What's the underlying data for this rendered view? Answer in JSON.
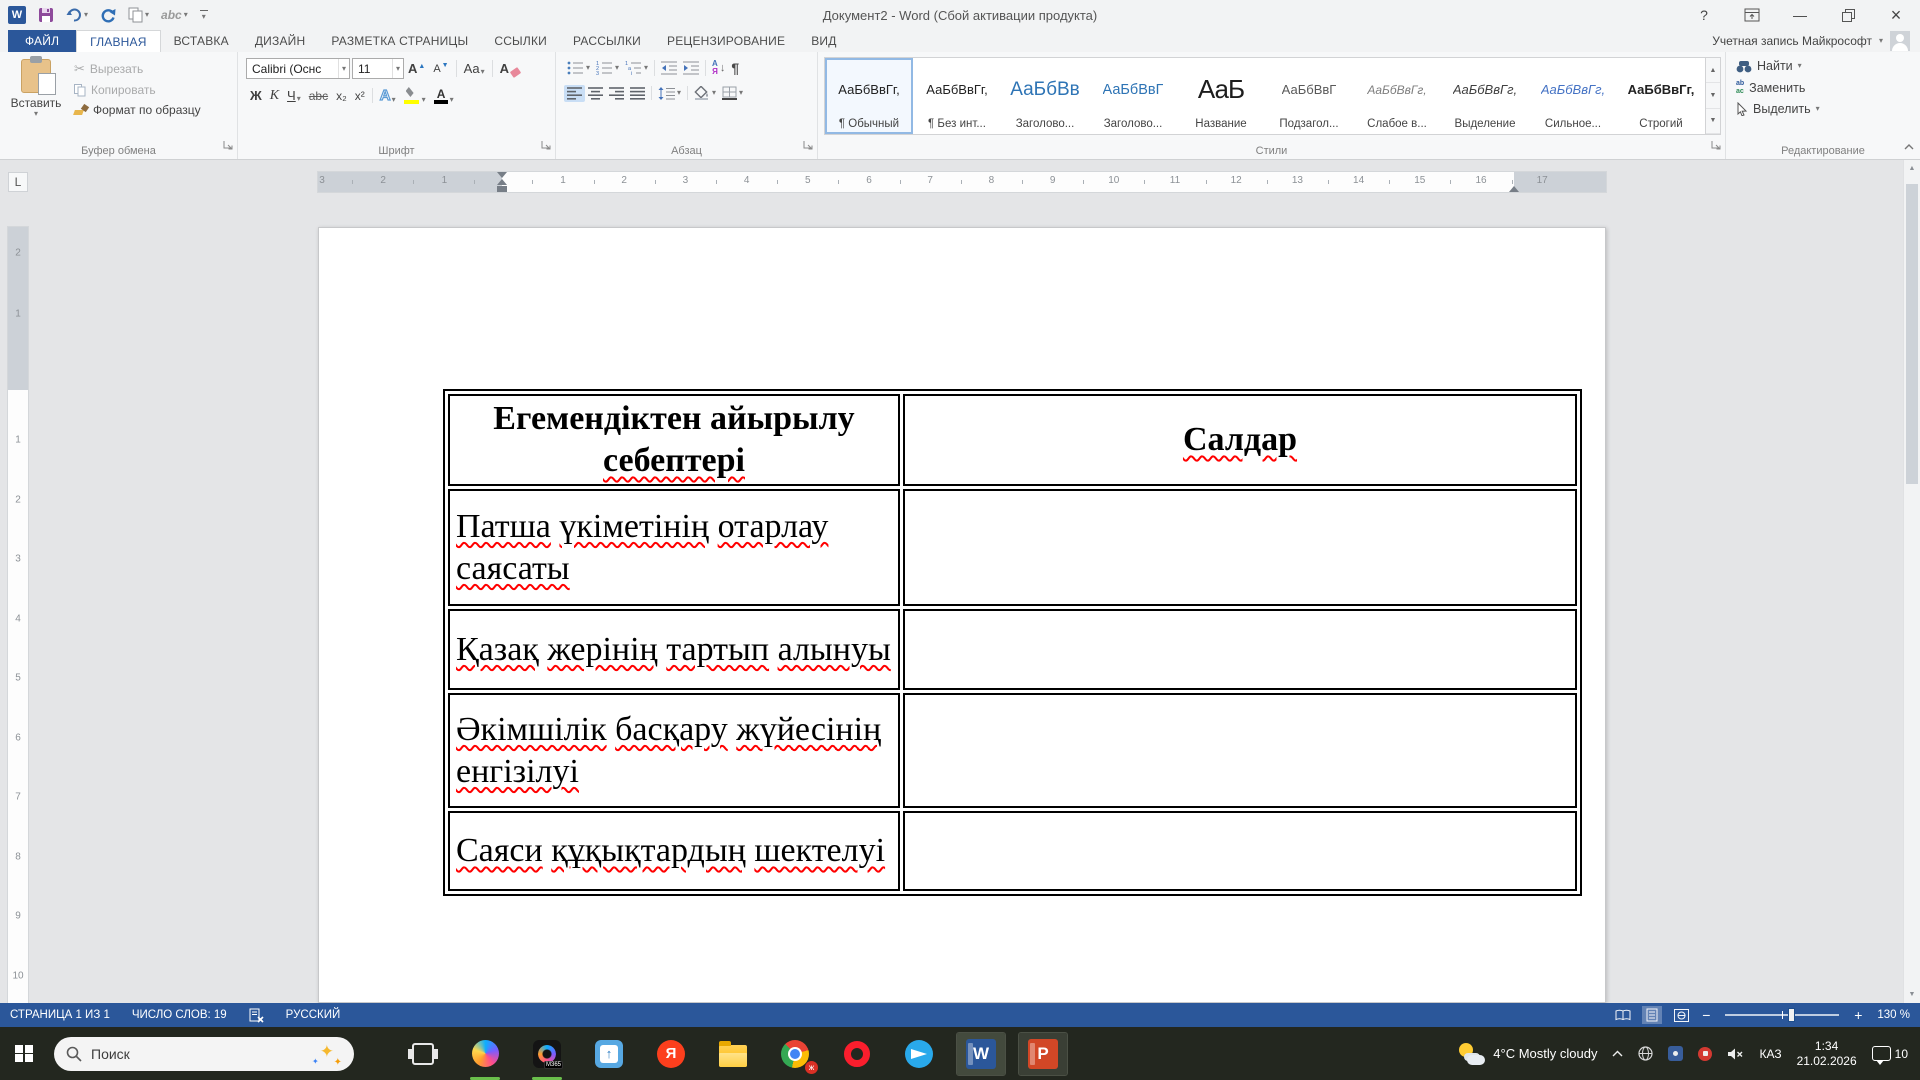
{
  "window": {
    "title": "Документ2 - Word (Сбой активации продукта)",
    "help": "?",
    "minimize": "—",
    "close": "×"
  },
  "qat": {
    "spelling_label": "abc"
  },
  "apps": {
    "word_letter": "W",
    "ppt_letter": "P",
    "yandex_letter": "Я",
    "m365_label": "M365",
    "chrome_badge": "ж"
  },
  "tabs": {
    "file": "ФАЙЛ",
    "active": "ГЛАВНАЯ",
    "items": [
      "ГЛАВНАЯ",
      "ВСТАВКА",
      "ДИЗАЙН",
      "РАЗМЕТКА СТРАНИЦЫ",
      "ССЫЛКИ",
      "РАССЫЛКИ",
      "РЕЦЕНЗИРОВАНИЕ",
      "ВИД"
    ],
    "account": "Учетная запись Майкрософт"
  },
  "ribbon": {
    "clipboard": {
      "label": "Буфер обмена",
      "paste": "Вставить",
      "cut": "Вырезать",
      "copy": "Копировать",
      "format_painter": "Формат по образцу"
    },
    "font": {
      "label": "Шрифт",
      "name": "Calibri (Оснс",
      "size": "11",
      "grow": "А",
      "shrink": "А",
      "case_btn": "Аа",
      "clear": "А",
      "bold": "Ж",
      "italic": "К",
      "underline": "Ч",
      "strike": "abc",
      "subscript": "x₂",
      "superscript": "x²",
      "effects": "А",
      "color_letter": "А"
    },
    "paragraph": {
      "label": "Абзац",
      "sort_a": "А",
      "sort_b": "Я",
      "pilcrow": "¶"
    },
    "styles": {
      "label": "Стили",
      "items": [
        {
          "preview": "АаБбВвГг,",
          "name": "¶ Обычный",
          "cls": "st-normal",
          "selected": true
        },
        {
          "preview": "АаБбВвГг,",
          "name": "¶ Без инт...",
          "cls": "st-normal",
          "selected": false
        },
        {
          "preview": "АаБбВв",
          "name": "Заголово...",
          "cls": "st-h1",
          "selected": false
        },
        {
          "preview": "АаБбВвГ",
          "name": "Заголово...",
          "cls": "st-h2",
          "selected": false
        },
        {
          "preview": "АаБ",
          "name": "Название",
          "cls": "st-title",
          "selected": false
        },
        {
          "preview": "АаБбВвГ",
          "name": "Подзагол...",
          "cls": "st-sub",
          "selected": false
        },
        {
          "preview": "АаБбВвГг,",
          "name": "Слабое в...",
          "cls": "st-subtle",
          "selected": false
        },
        {
          "preview": "АаБбВвГг,",
          "name": "Выделение",
          "cls": "st-emph",
          "selected": false
        },
        {
          "preview": "АаБбВвГг,",
          "name": "Сильное...",
          "cls": "st-strong",
          "selected": false
        },
        {
          "preview": "АаБбВвГг,",
          "name": "Строгий",
          "cls": "st-strict",
          "selected": false
        }
      ]
    },
    "editing": {
      "label": "Редактирование",
      "find": "Найти",
      "replace": "Заменить",
      "select": "Выделить",
      "replace_ab": "ab",
      "replace_ac": "ac"
    }
  },
  "ruler": {
    "tab_selector": "L",
    "left": [
      "3",
      "2",
      "1"
    ],
    "main": [
      "1",
      "2",
      "3",
      "4",
      "5",
      "6",
      "7",
      "8",
      "9",
      "10",
      "11",
      "12",
      "13",
      "14",
      "15",
      "16",
      "17"
    ],
    "vertical_margin": [
      "2",
      "1"
    ],
    "vertical": [
      "1",
      "2",
      "3",
      "4",
      "5",
      "6",
      "7",
      "8",
      "9",
      "10"
    ]
  },
  "table": {
    "header": [
      {
        "text": "Егемендіктен айырылу себептері",
        "clean": [
          0,
          1
        ]
      },
      {
        "text": "Салдар",
        "clean": []
      }
    ],
    "rows": [
      [
        {
          "text": "Патша үкіметінің отарлау саясаты"
        },
        {
          "text": ""
        }
      ],
      [
        {
          "text": "Қазақ жерінің тартып алынуы"
        },
        {
          "text": ""
        }
      ],
      [
        {
          "text": "Әкімшілік басқару жүйесінің енгізілуі"
        },
        {
          "text": ""
        }
      ],
      [
        {
          "text": "Саяси құқықтардың шектелуі"
        },
        {
          "text": ""
        }
      ]
    ]
  },
  "status": {
    "page": "СТРАНИЦА 1 ИЗ 1",
    "words": "ЧИСЛО СЛОВ: 19",
    "language": "РУССКИЙ",
    "zoom": "130 %",
    "zoom_minus": "−",
    "zoom_plus": "+"
  },
  "taskbar": {
    "search_placeholder": "Поиск",
    "weather": "4°C Mostly cloudy",
    "lang": "КАЗ",
    "time": "1:34",
    "date": "21.02.2026",
    "notifications": "10"
  }
}
